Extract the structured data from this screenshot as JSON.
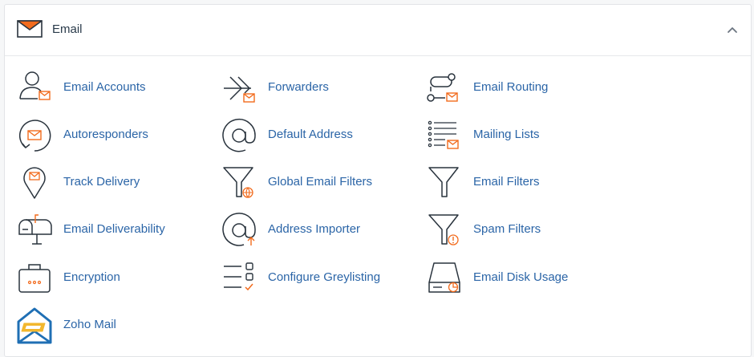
{
  "section": {
    "title": "Email",
    "icon": "envelope-icon",
    "collapse_icon": "chevron-up-icon",
    "accent_color": "#f26b1d",
    "link_color": "#2b65a7",
    "icon_stroke_color": "#29333d"
  },
  "items": [
    {
      "label": "Email Accounts",
      "icon": "user-mail-icon"
    },
    {
      "label": "Forwarders",
      "icon": "forward-arrow-icon"
    },
    {
      "label": "Email Routing",
      "icon": "routing-icon"
    },
    {
      "label": "Autoresponders",
      "icon": "autoresponder-icon"
    },
    {
      "label": "Default Address",
      "icon": "at-sign-icon"
    },
    {
      "label": "Mailing Lists",
      "icon": "mailing-list-icon"
    },
    {
      "label": "Track Delivery",
      "icon": "map-pin-mail-icon"
    },
    {
      "label": "Global Email Filters",
      "icon": "funnel-globe-icon"
    },
    {
      "label": "Email Filters",
      "icon": "funnel-icon"
    },
    {
      "label": "Email Deliverability",
      "icon": "mailbox-icon"
    },
    {
      "label": "Address Importer",
      "icon": "at-import-icon"
    },
    {
      "label": "Spam Filters",
      "icon": "funnel-warning-icon"
    },
    {
      "label": "Encryption",
      "icon": "briefcase-lock-icon"
    },
    {
      "label": "Configure Greylisting",
      "icon": "checklist-icon"
    },
    {
      "label": "Email Disk Usage",
      "icon": "disk-usage-icon"
    },
    {
      "label": "Zoho Mail",
      "icon": "zoho-mail-icon"
    }
  ]
}
